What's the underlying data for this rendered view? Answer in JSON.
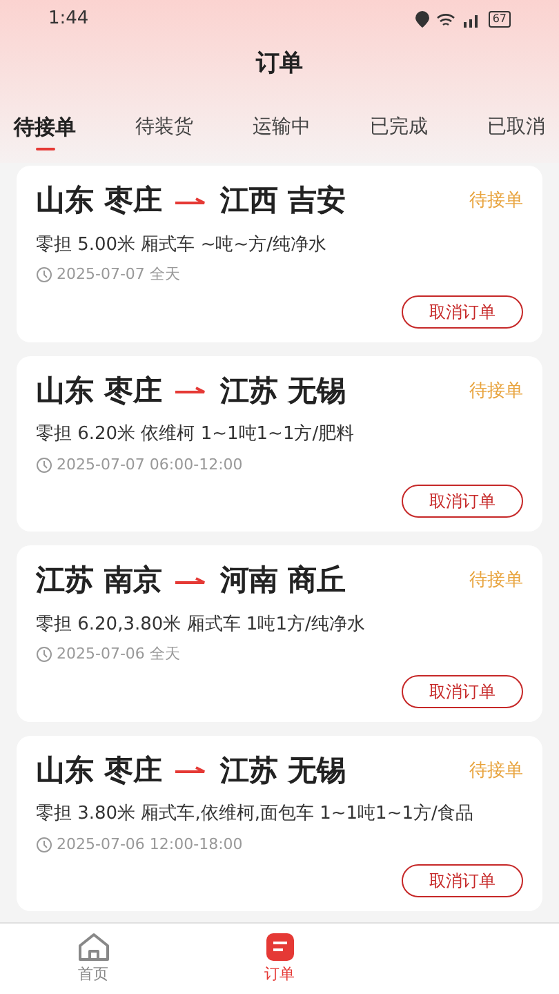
{
  "status_bar": {
    "time": "1:44",
    "battery": "67"
  },
  "title": "订单",
  "tabs": [
    {
      "label": "待接单",
      "selected": true
    },
    {
      "label": "待装货",
      "selected": false
    },
    {
      "label": "运输中",
      "selected": false
    },
    {
      "label": "已完成",
      "selected": false
    },
    {
      "label": "已取消",
      "selected": false
    }
  ],
  "orders": [
    {
      "from": "山东 枣庄",
      "to": "江西 吉安",
      "status": "待接单",
      "detail": "零担 5.00米 厢式车 ~吨~方/纯净水",
      "time": "2025-07-07 全天",
      "action": "取消订单"
    },
    {
      "from": "山东 枣庄",
      "to": "江苏 无锡",
      "status": "待接单",
      "detail": "零担 6.20米 依维柯 1~1吨1~1方/肥料",
      "time": "2025-07-07 06:00-12:00",
      "action": "取消订单"
    },
    {
      "from": "江苏 南京",
      "to": "河南 商丘",
      "status": "待接单",
      "detail": "零担 6.20,3.80米 厢式车 1吨1方/纯净水",
      "time": "2025-07-06 全天",
      "action": "取消订单"
    },
    {
      "from": "山东 枣庄",
      "to": "江苏 无锡",
      "status": "待接单",
      "detail": "零担 3.80米 厢式车,依维柯,面包车 1~1吨1~1方/食品",
      "time": "2025-07-06 12:00-18:00",
      "action": "取消订单"
    }
  ],
  "bottom_nav": [
    {
      "label": "首页",
      "kind": "home",
      "selected": false
    },
    {
      "label": "订单",
      "kind": "orders",
      "selected": true
    }
  ]
}
